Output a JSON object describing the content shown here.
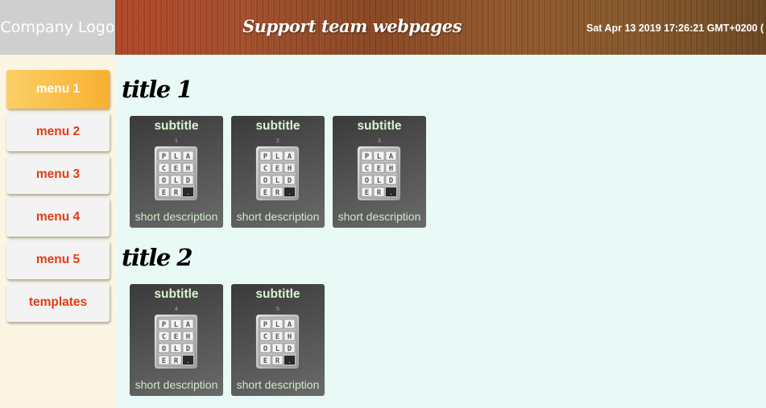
{
  "header": {
    "logo_text": "Company Logo",
    "title": "Support team webpages",
    "datetime": "Sat Apr 13 2019 17:26:21 GMT+0200 ("
  },
  "sidebar": {
    "items": [
      {
        "label": "menu 1",
        "active": true
      },
      {
        "label": "menu 2",
        "active": false
      },
      {
        "label": "menu 3",
        "active": false
      },
      {
        "label": "menu 4",
        "active": false
      },
      {
        "label": "menu 5",
        "active": false
      },
      {
        "label": "templates",
        "active": false
      }
    ]
  },
  "sections": [
    {
      "title": "title 1",
      "cards": [
        {
          "subtitle": "subtitle",
          "number": "1",
          "description": "short description",
          "image": "placeholder-icon"
        },
        {
          "subtitle": "subtitle",
          "number": "2",
          "description": "short description",
          "image": "placeholder-icon"
        },
        {
          "subtitle": "subtitle",
          "number": "3",
          "description": "short description",
          "image": "placeholder-icon"
        }
      ]
    },
    {
      "title": "title 2",
      "cards": [
        {
          "subtitle": "subtitle",
          "number": "4",
          "description": "short description",
          "image": "placeholder-icon"
        },
        {
          "subtitle": "subtitle",
          "number": "5",
          "description": "short description",
          "image": "placeholder-icon"
        }
      ]
    }
  ],
  "colors": {
    "menu_text": "#e33b12",
    "menu_active": "#f8b030",
    "content_bg": "#e8f9f6",
    "sidebar_bg": "#fdf5e4",
    "card_text": "#d8f5d2"
  }
}
